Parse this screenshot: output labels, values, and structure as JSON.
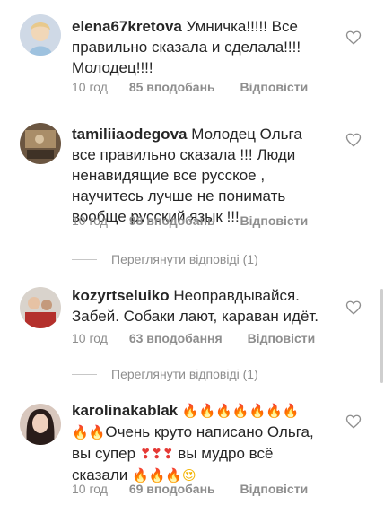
{
  "comments": [
    {
      "username": "elena67kretova",
      "text_lines": [
        "Умничка!!!!! Все",
        "правильно сказала  и сделала!!!!",
        "Молодец!!!!"
      ],
      "time": "10 год",
      "likes": "85 вподобань",
      "reply": "Відповісти"
    },
    {
      "username": "tamiliiaodegova",
      "text_lines": [
        "Молодец Ольга",
        "все правильно сказала !!! Люди",
        "ненавидящие все русское ,",
        "научитесь лучше не понимать",
        "вообще русский язык !!!"
      ],
      "time": "10 год",
      "likes": "98 вподобань",
      "reply": "Відповісти",
      "view_replies": "Переглянути відповіді (1)"
    },
    {
      "username": "kozyrtseluiko",
      "text_lines": [
        "Неоправдывайся.",
        "Забей. Собаки лают, караван идёт."
      ],
      "time": "10 год",
      "likes": "63 вподобання",
      "reply": "Відповісти",
      "view_replies": "Переглянути відповіді (1)"
    },
    {
      "username": "karolinakablak",
      "text_lines": [
        "Очень круто написано Ольга,",
        "вы супер",
        "вы мудро всё",
        "сказали"
      ],
      "time": "10 год",
      "likes": "69 вподобань",
      "reply": "Відповісти"
    }
  ],
  "icons": {
    "heart": "heart-outline-icon",
    "fire": "🔥",
    "red_heart": "❣",
    "smile": "😍"
  },
  "colors": {
    "text": "#262626",
    "meta": "#8e8e8e"
  }
}
